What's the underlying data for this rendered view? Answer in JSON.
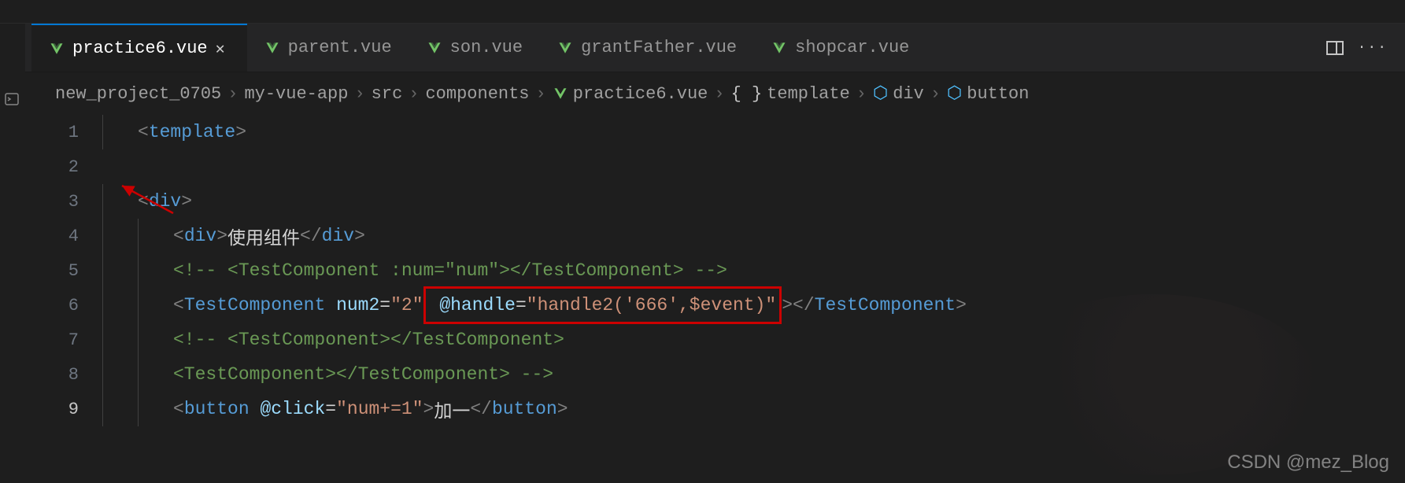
{
  "tabs": [
    {
      "label": "practice6.vue",
      "active": true,
      "closable": true
    },
    {
      "label": "parent.vue",
      "active": false,
      "closable": false
    },
    {
      "label": "son.vue",
      "active": false,
      "closable": false
    },
    {
      "label": "grantFather.vue",
      "active": false,
      "closable": false
    },
    {
      "label": "shopcar.vue",
      "active": false,
      "closable": false
    }
  ],
  "breadcrumb": {
    "items": [
      "new_project_0705",
      "my-vue-app",
      "src",
      "components",
      "practice6.vue",
      "template",
      "div",
      "button"
    ]
  },
  "lines": {
    "1": {
      "num": "1"
    },
    "2": {
      "num": "2"
    },
    "3": {
      "num": "3"
    },
    "4": {
      "num": "4",
      "text": "使用组件"
    },
    "5": {
      "num": "5",
      "comment": "<!-- <TestComponent :num=\"num\"></TestComponent> -->"
    },
    "6": {
      "num": "6",
      "tag": "TestComponent",
      "attr1": "num2",
      "val1": "\"2\"",
      "attr2": "@handle",
      "val2": "\"handle2('666',$event)\""
    },
    "7": {
      "num": "7",
      "comment": "<!-- <TestComponent></TestComponent>"
    },
    "8": {
      "num": "8",
      "comment": "<TestComponent></TestComponent> -->"
    },
    "9": {
      "num": "9",
      "tag": "button",
      "attr": "@click",
      "val": "\"num+=1\"",
      "text": "加一"
    }
  },
  "watermark": "CSDN @mez_Blog"
}
